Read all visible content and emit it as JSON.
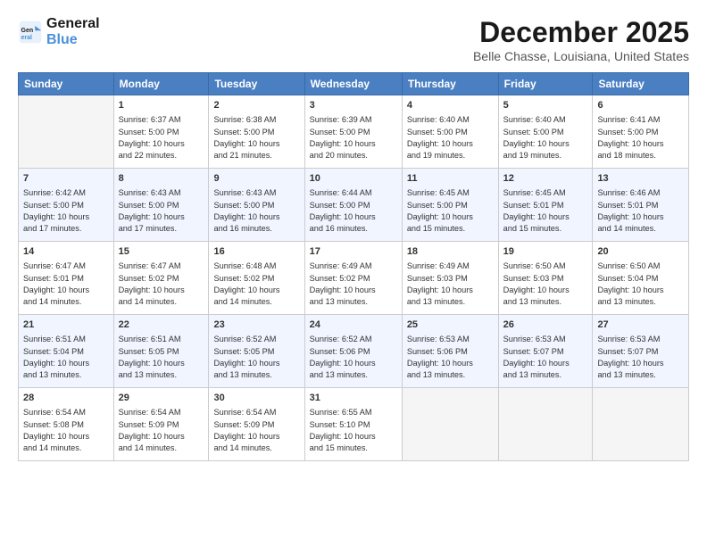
{
  "header": {
    "logo_line1": "General",
    "logo_line2": "Blue",
    "title": "December 2025",
    "subtitle": "Belle Chasse, Louisiana, United States"
  },
  "weekdays": [
    "Sunday",
    "Monday",
    "Tuesday",
    "Wednesday",
    "Thursday",
    "Friday",
    "Saturday"
  ],
  "weeks": [
    [
      {
        "day": "",
        "info": ""
      },
      {
        "day": "1",
        "info": "Sunrise: 6:37 AM\nSunset: 5:00 PM\nDaylight: 10 hours\nand 22 minutes."
      },
      {
        "day": "2",
        "info": "Sunrise: 6:38 AM\nSunset: 5:00 PM\nDaylight: 10 hours\nand 21 minutes."
      },
      {
        "day": "3",
        "info": "Sunrise: 6:39 AM\nSunset: 5:00 PM\nDaylight: 10 hours\nand 20 minutes."
      },
      {
        "day": "4",
        "info": "Sunrise: 6:40 AM\nSunset: 5:00 PM\nDaylight: 10 hours\nand 19 minutes."
      },
      {
        "day": "5",
        "info": "Sunrise: 6:40 AM\nSunset: 5:00 PM\nDaylight: 10 hours\nand 19 minutes."
      },
      {
        "day": "6",
        "info": "Sunrise: 6:41 AM\nSunset: 5:00 PM\nDaylight: 10 hours\nand 18 minutes."
      }
    ],
    [
      {
        "day": "7",
        "info": "Sunrise: 6:42 AM\nSunset: 5:00 PM\nDaylight: 10 hours\nand 17 minutes."
      },
      {
        "day": "8",
        "info": "Sunrise: 6:43 AM\nSunset: 5:00 PM\nDaylight: 10 hours\nand 17 minutes."
      },
      {
        "day": "9",
        "info": "Sunrise: 6:43 AM\nSunset: 5:00 PM\nDaylight: 10 hours\nand 16 minutes."
      },
      {
        "day": "10",
        "info": "Sunrise: 6:44 AM\nSunset: 5:00 PM\nDaylight: 10 hours\nand 16 minutes."
      },
      {
        "day": "11",
        "info": "Sunrise: 6:45 AM\nSunset: 5:00 PM\nDaylight: 10 hours\nand 15 minutes."
      },
      {
        "day": "12",
        "info": "Sunrise: 6:45 AM\nSunset: 5:01 PM\nDaylight: 10 hours\nand 15 minutes."
      },
      {
        "day": "13",
        "info": "Sunrise: 6:46 AM\nSunset: 5:01 PM\nDaylight: 10 hours\nand 14 minutes."
      }
    ],
    [
      {
        "day": "14",
        "info": "Sunrise: 6:47 AM\nSunset: 5:01 PM\nDaylight: 10 hours\nand 14 minutes."
      },
      {
        "day": "15",
        "info": "Sunrise: 6:47 AM\nSunset: 5:02 PM\nDaylight: 10 hours\nand 14 minutes."
      },
      {
        "day": "16",
        "info": "Sunrise: 6:48 AM\nSunset: 5:02 PM\nDaylight: 10 hours\nand 14 minutes."
      },
      {
        "day": "17",
        "info": "Sunrise: 6:49 AM\nSunset: 5:02 PM\nDaylight: 10 hours\nand 13 minutes."
      },
      {
        "day": "18",
        "info": "Sunrise: 6:49 AM\nSunset: 5:03 PM\nDaylight: 10 hours\nand 13 minutes."
      },
      {
        "day": "19",
        "info": "Sunrise: 6:50 AM\nSunset: 5:03 PM\nDaylight: 10 hours\nand 13 minutes."
      },
      {
        "day": "20",
        "info": "Sunrise: 6:50 AM\nSunset: 5:04 PM\nDaylight: 10 hours\nand 13 minutes."
      }
    ],
    [
      {
        "day": "21",
        "info": "Sunrise: 6:51 AM\nSunset: 5:04 PM\nDaylight: 10 hours\nand 13 minutes."
      },
      {
        "day": "22",
        "info": "Sunrise: 6:51 AM\nSunset: 5:05 PM\nDaylight: 10 hours\nand 13 minutes."
      },
      {
        "day": "23",
        "info": "Sunrise: 6:52 AM\nSunset: 5:05 PM\nDaylight: 10 hours\nand 13 minutes."
      },
      {
        "day": "24",
        "info": "Sunrise: 6:52 AM\nSunset: 5:06 PM\nDaylight: 10 hours\nand 13 minutes."
      },
      {
        "day": "25",
        "info": "Sunrise: 6:53 AM\nSunset: 5:06 PM\nDaylight: 10 hours\nand 13 minutes."
      },
      {
        "day": "26",
        "info": "Sunrise: 6:53 AM\nSunset: 5:07 PM\nDaylight: 10 hours\nand 13 minutes."
      },
      {
        "day": "27",
        "info": "Sunrise: 6:53 AM\nSunset: 5:07 PM\nDaylight: 10 hours\nand 13 minutes."
      }
    ],
    [
      {
        "day": "28",
        "info": "Sunrise: 6:54 AM\nSunset: 5:08 PM\nDaylight: 10 hours\nand 14 minutes."
      },
      {
        "day": "29",
        "info": "Sunrise: 6:54 AM\nSunset: 5:09 PM\nDaylight: 10 hours\nand 14 minutes."
      },
      {
        "day": "30",
        "info": "Sunrise: 6:54 AM\nSunset: 5:09 PM\nDaylight: 10 hours\nand 14 minutes."
      },
      {
        "day": "31",
        "info": "Sunrise: 6:55 AM\nSunset: 5:10 PM\nDaylight: 10 hours\nand 15 minutes."
      },
      {
        "day": "",
        "info": ""
      },
      {
        "day": "",
        "info": ""
      },
      {
        "day": "",
        "info": ""
      }
    ]
  ]
}
